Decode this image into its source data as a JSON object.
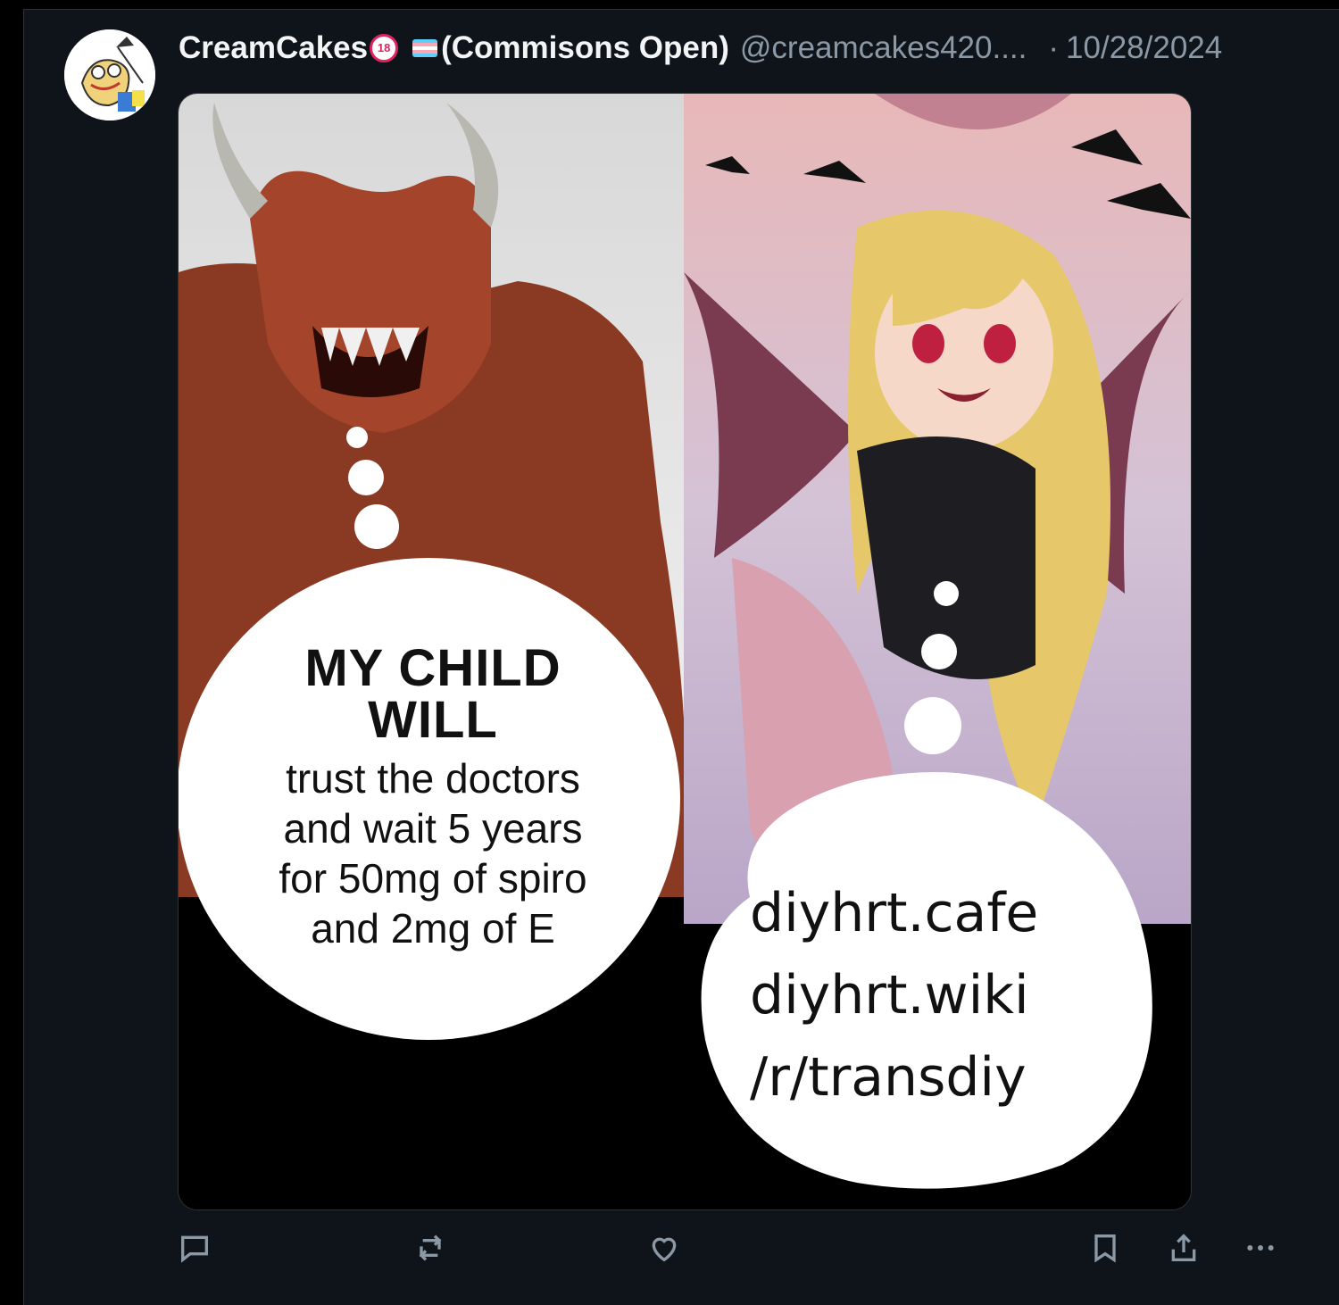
{
  "post": {
    "author_name": "CreamCakes",
    "nsfw_badge": "18",
    "display_suffix": "(Commisons Open)",
    "handle": "@creamcakes420....",
    "separator": "·",
    "date": "10/28/2024"
  },
  "media": {
    "left_panel": {
      "heading_line1": "MY CHILD",
      "heading_line2": "WILL",
      "body_lines": [
        "trust the doctors",
        "and wait 5 years",
        "for 50mg of spiro",
        "and 2mg of E"
      ]
    },
    "right_panel": {
      "lines": [
        "diyhrt.cafe",
        "diyhrt.wiki",
        "/r/transdiy"
      ]
    }
  },
  "actions": {
    "icons": [
      "reply-icon",
      "repost-icon",
      "like-icon",
      "bookmark-icon",
      "share-icon",
      "more-icon"
    ]
  },
  "colors": {
    "background": "#000000",
    "panel": "#0f141a",
    "muted_text": "#8b98a5",
    "icon": "#8b98a5"
  }
}
